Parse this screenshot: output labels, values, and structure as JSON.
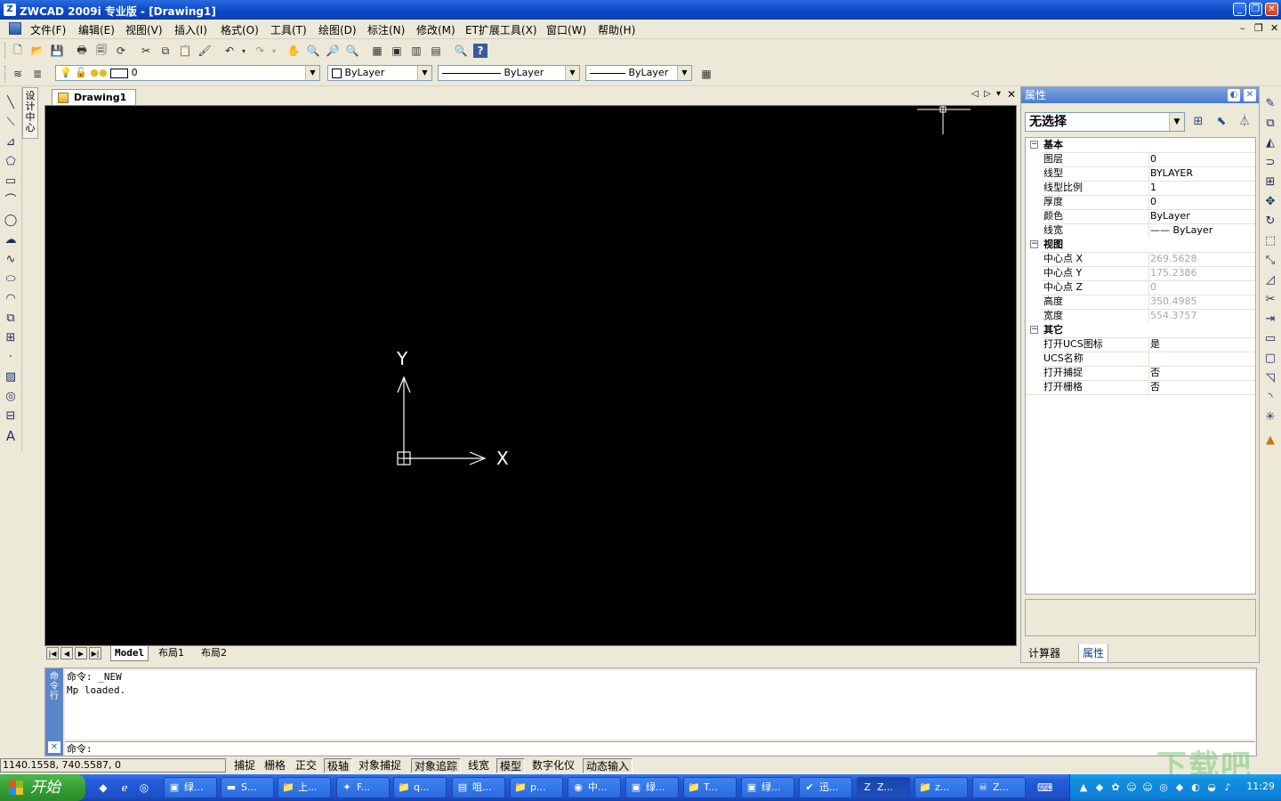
{
  "window": {
    "title": "ZWCAD 2009i 专业版 - [Drawing1]",
    "controls": [
      "minimize",
      "restore",
      "close"
    ]
  },
  "menu": {
    "items": [
      "文件(F)",
      "编辑(E)",
      "视图(V)",
      "插入(I)",
      "格式(O)",
      "工具(T)",
      "绘图(D)",
      "标注(N)",
      "修改(M)",
      "ET扩展工具(X)",
      "窗口(W)",
      "帮助(H)"
    ]
  },
  "layer_toolbar": {
    "layer_value": "0",
    "color_value": "ByLayer",
    "linetype_value": "ByLayer",
    "lineweight_value": "ByLayer"
  },
  "left_panel": {
    "design_center": "设计中心"
  },
  "document": {
    "tab": "Drawing1"
  },
  "canvas": {
    "background": "#000000",
    "ucs_x": "X",
    "ucs_y": "Y"
  },
  "layout_tabs": [
    "Model",
    "布局1",
    "布局2"
  ],
  "properties": {
    "title": "属性",
    "selection": "无选择",
    "categories": [
      {
        "name": "基本",
        "rows": [
          {
            "key": "图层",
            "value": "0",
            "enabled": true
          },
          {
            "key": "线型",
            "value": "BYLAYER",
            "enabled": true
          },
          {
            "key": "线型比例",
            "value": "1",
            "enabled": true
          },
          {
            "key": "厚度",
            "value": "0",
            "enabled": true
          },
          {
            "key": "颜色",
            "value": "ByLayer",
            "enabled": true
          },
          {
            "key": "线宽",
            "value": "—— ByLayer",
            "enabled": true
          }
        ]
      },
      {
        "name": "视图",
        "rows": [
          {
            "key": "中心点 X",
            "value": "269.5628",
            "enabled": false
          },
          {
            "key": "中心点 Y",
            "value": "175.2386",
            "enabled": false
          },
          {
            "key": "中心点 Z",
            "value": "0",
            "enabled": false
          },
          {
            "key": "高度",
            "value": "350.4985",
            "enabled": false
          },
          {
            "key": "宽度",
            "value": "554.3757",
            "enabled": false
          }
        ]
      },
      {
        "name": "其它",
        "rows": [
          {
            "key": "打开UCS图标",
            "value": "是",
            "enabled": true
          },
          {
            "key": "UCS名称",
            "value": "",
            "enabled": true
          },
          {
            "key": "打开捕捉",
            "value": "否",
            "enabled": true
          },
          {
            "key": "打开栅格",
            "value": "否",
            "enabled": true
          }
        ]
      }
    ],
    "tabs": [
      "计算器",
      "属性"
    ]
  },
  "command": {
    "side_label": "命令行",
    "history": [
      "命令: _NEW",
      "Mp loaded."
    ],
    "prompt": "命令:"
  },
  "status": {
    "coords": "1140.1558,  740.5587,  0",
    "toggles": [
      {
        "label": "捕捉",
        "on": false
      },
      {
        "label": "栅格",
        "on": false
      },
      {
        "label": "正交",
        "on": false
      },
      {
        "label": "极轴",
        "on": true
      },
      {
        "label": "对象捕捉",
        "on": false
      },
      {
        "label": "对象追踪",
        "on": true
      },
      {
        "label": "线宽",
        "on": false
      },
      {
        "label": "模型",
        "on": true
      },
      {
        "label": "数字化仪",
        "on": false
      },
      {
        "label": "动态输入",
        "on": true
      }
    ]
  },
  "taskbar": {
    "start": "开始",
    "tasks": [
      "绿...",
      "S...",
      "上...",
      "F...",
      "q...",
      "咀...",
      "p...",
      "中...",
      "绿...",
      "T...",
      "绿...",
      "迅...",
      "Z...",
      "z...",
      "Z..."
    ],
    "clock": "11:29"
  },
  "watermark": "下载吧"
}
